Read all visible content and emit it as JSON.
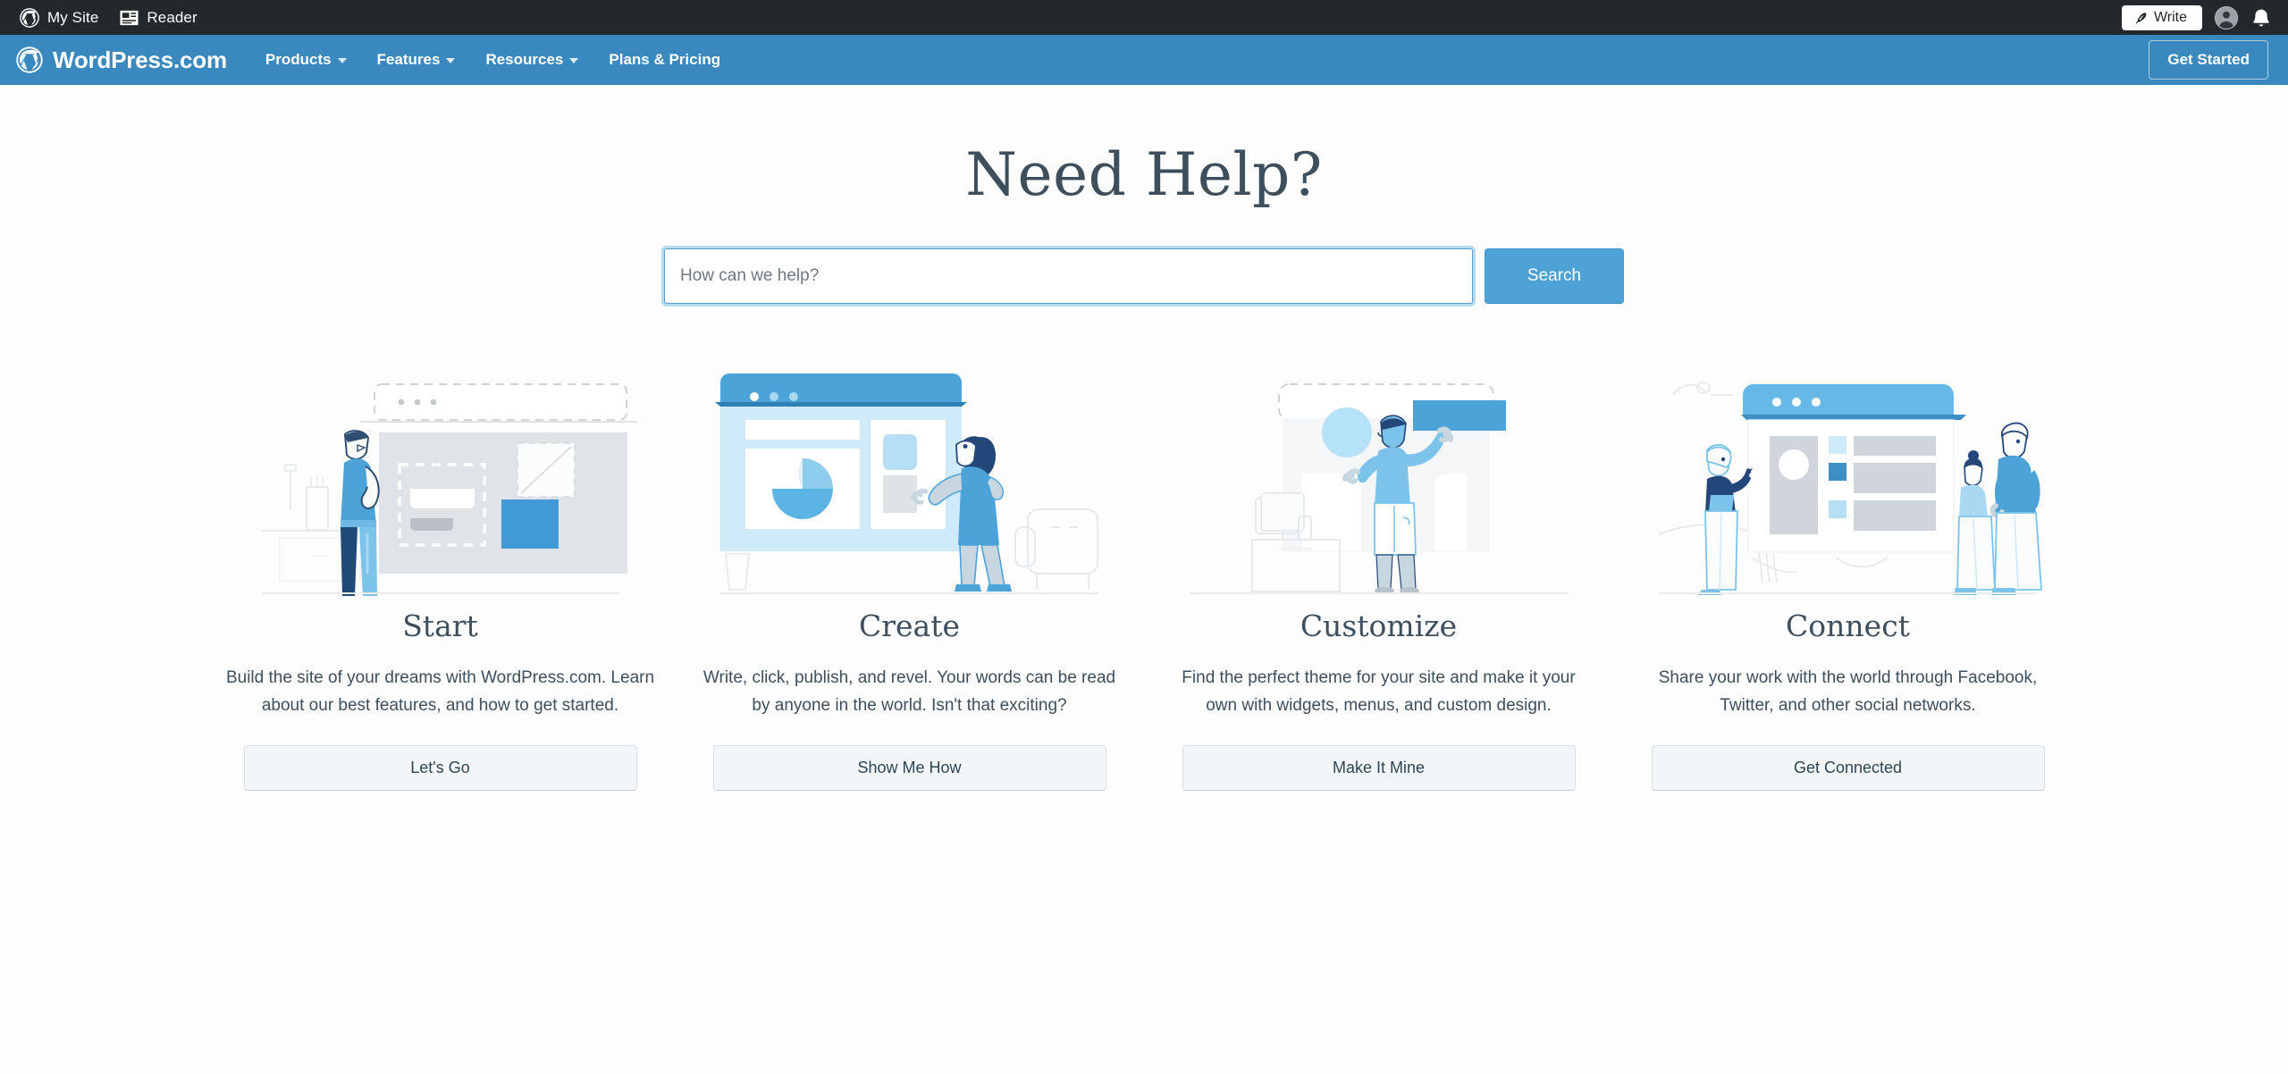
{
  "masterbar": {
    "items": [
      {
        "label": "My Site",
        "icon": "wordpress-logo-icon"
      },
      {
        "label": "Reader",
        "icon": "reader-icon"
      }
    ],
    "write_label": "Write",
    "write_icon": "pencil-icon",
    "avatar_icon": "user-avatar",
    "bell_icon": "bell-icon",
    "background": "#23282d"
  },
  "navbar": {
    "brand": "WordPress.com",
    "brand_icon": "wordpress-logo-icon",
    "links": [
      {
        "label": "Products",
        "has_caret": true
      },
      {
        "label": "Features",
        "has_caret": true
      },
      {
        "label": "Resources",
        "has_caret": true
      },
      {
        "label": "Plans & Pricing",
        "has_caret": false
      }
    ],
    "get_started": "Get Started",
    "background": "#3989bf"
  },
  "hero": {
    "title": "Need Help?",
    "search_placeholder": "How can we help?",
    "search_value": "",
    "search_button": "Search",
    "search_button_color": "#4ea2d6",
    "focus_ring_color": "#78bee6"
  },
  "cards": [
    {
      "title": "Start",
      "description": "Build the site of your dreams with WordPress.com. Learn about our best features, and how to get started.",
      "cta": "Let's Go",
      "illustration": "person-thinking-at-wireframe-illustration"
    },
    {
      "title": "Create",
      "description": "Write, click, publish, and revel. Your words can be read by anyone in the world. Isn't that exciting?",
      "cta": "Show Me How",
      "illustration": "woman-viewing-browser-with-pie-chart-illustration"
    },
    {
      "title": "Customize",
      "description": "Find the perfect theme for your site and make it your own with widgets, menus, and custom design.",
      "cta": "Make It Mine",
      "illustration": "person-arranging-layout-blocks-illustration"
    },
    {
      "title": "Connect",
      "description": "Share your work with the world through Facebook, Twitter, and other social networks.",
      "cta": "Get Connected",
      "illustration": "people-around-social-feed-browser-illustration"
    }
  ]
}
